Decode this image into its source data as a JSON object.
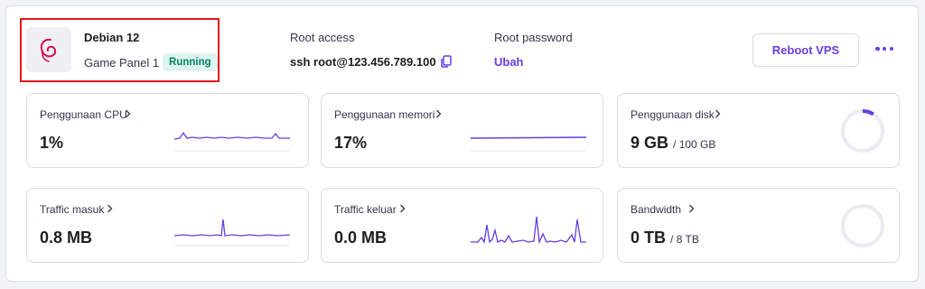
{
  "server": {
    "os_name": "Debian 12",
    "panel_name": "Game Panel 1",
    "status": "Running",
    "logo_icon": "debian-logo-icon",
    "status_color": "#008361"
  },
  "root_access": {
    "label": "Root access",
    "value": "ssh root@123.456.789.100"
  },
  "root_password": {
    "label": "Root password",
    "action": "Ubah"
  },
  "actions": {
    "reboot_label": "Reboot VPS",
    "more_icon": "more-dots-icon"
  },
  "accent_color": "#673de6",
  "cards": {
    "cpu": {
      "title": "Penggunaan CPU",
      "value": "1%"
    },
    "memory": {
      "title": "Penggunaan memori",
      "value": "17%"
    },
    "disk": {
      "title": "Penggunaan disk",
      "value": "9 GB",
      "total": "/ 100 GB",
      "used_fraction": 0.09
    },
    "traffic_in": {
      "title": "Traffic masuk",
      "value": "0.8 MB"
    },
    "traffic_out": {
      "title": "Traffic keluar",
      "value": "0.0 MB"
    },
    "bandwidth": {
      "title": "Bandwidth",
      "value": "0 TB",
      "total": "/ 8 TB",
      "used_fraction": 0.0
    }
  }
}
